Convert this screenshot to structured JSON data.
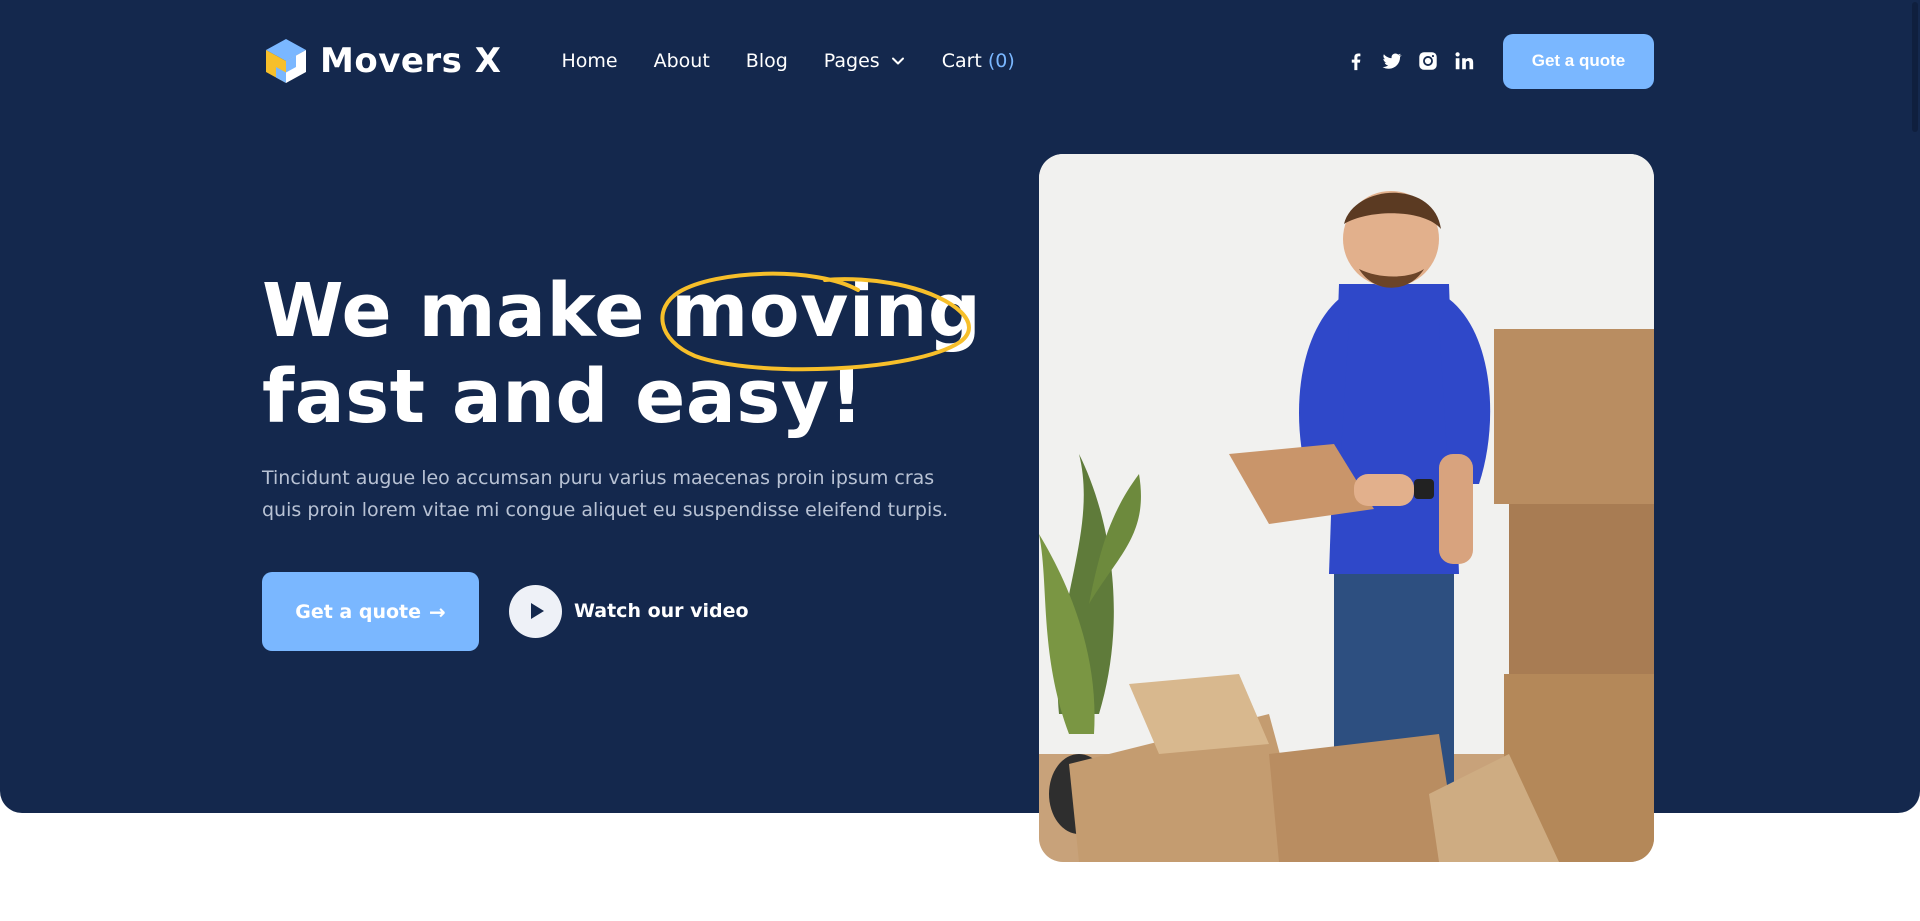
{
  "brand": {
    "name": "Movers X"
  },
  "nav": {
    "items": [
      {
        "label": "Home"
      },
      {
        "label": "About"
      },
      {
        "label": "Blog"
      },
      {
        "label": "Pages"
      }
    ],
    "cart": {
      "label": "Cart",
      "count": "(0)"
    }
  },
  "social": [
    "facebook-icon",
    "twitter-icon",
    "instagram-icon",
    "linkedin-icon"
  ],
  "header": {
    "cta_label": "Get a quote"
  },
  "hero": {
    "headline_part1": "We make",
    "headline_highlight": "moving",
    "headline_line2": "fast and easy!",
    "subtext": "Tincidunt augue leo accumsan puru varius maecenas proin ipsum cras quis proin lorem vitae mi congue aliquet eu suspendisse eleifend turpis.",
    "cta_label": "Get a quote",
    "cta_arrow": "→",
    "video_label": "Watch our video"
  },
  "colors": {
    "navy": "#14284d",
    "accent_blue": "#7ab7ff",
    "highlight_yellow": "#f7bf2a",
    "text_muted": "#b8c2d4"
  }
}
